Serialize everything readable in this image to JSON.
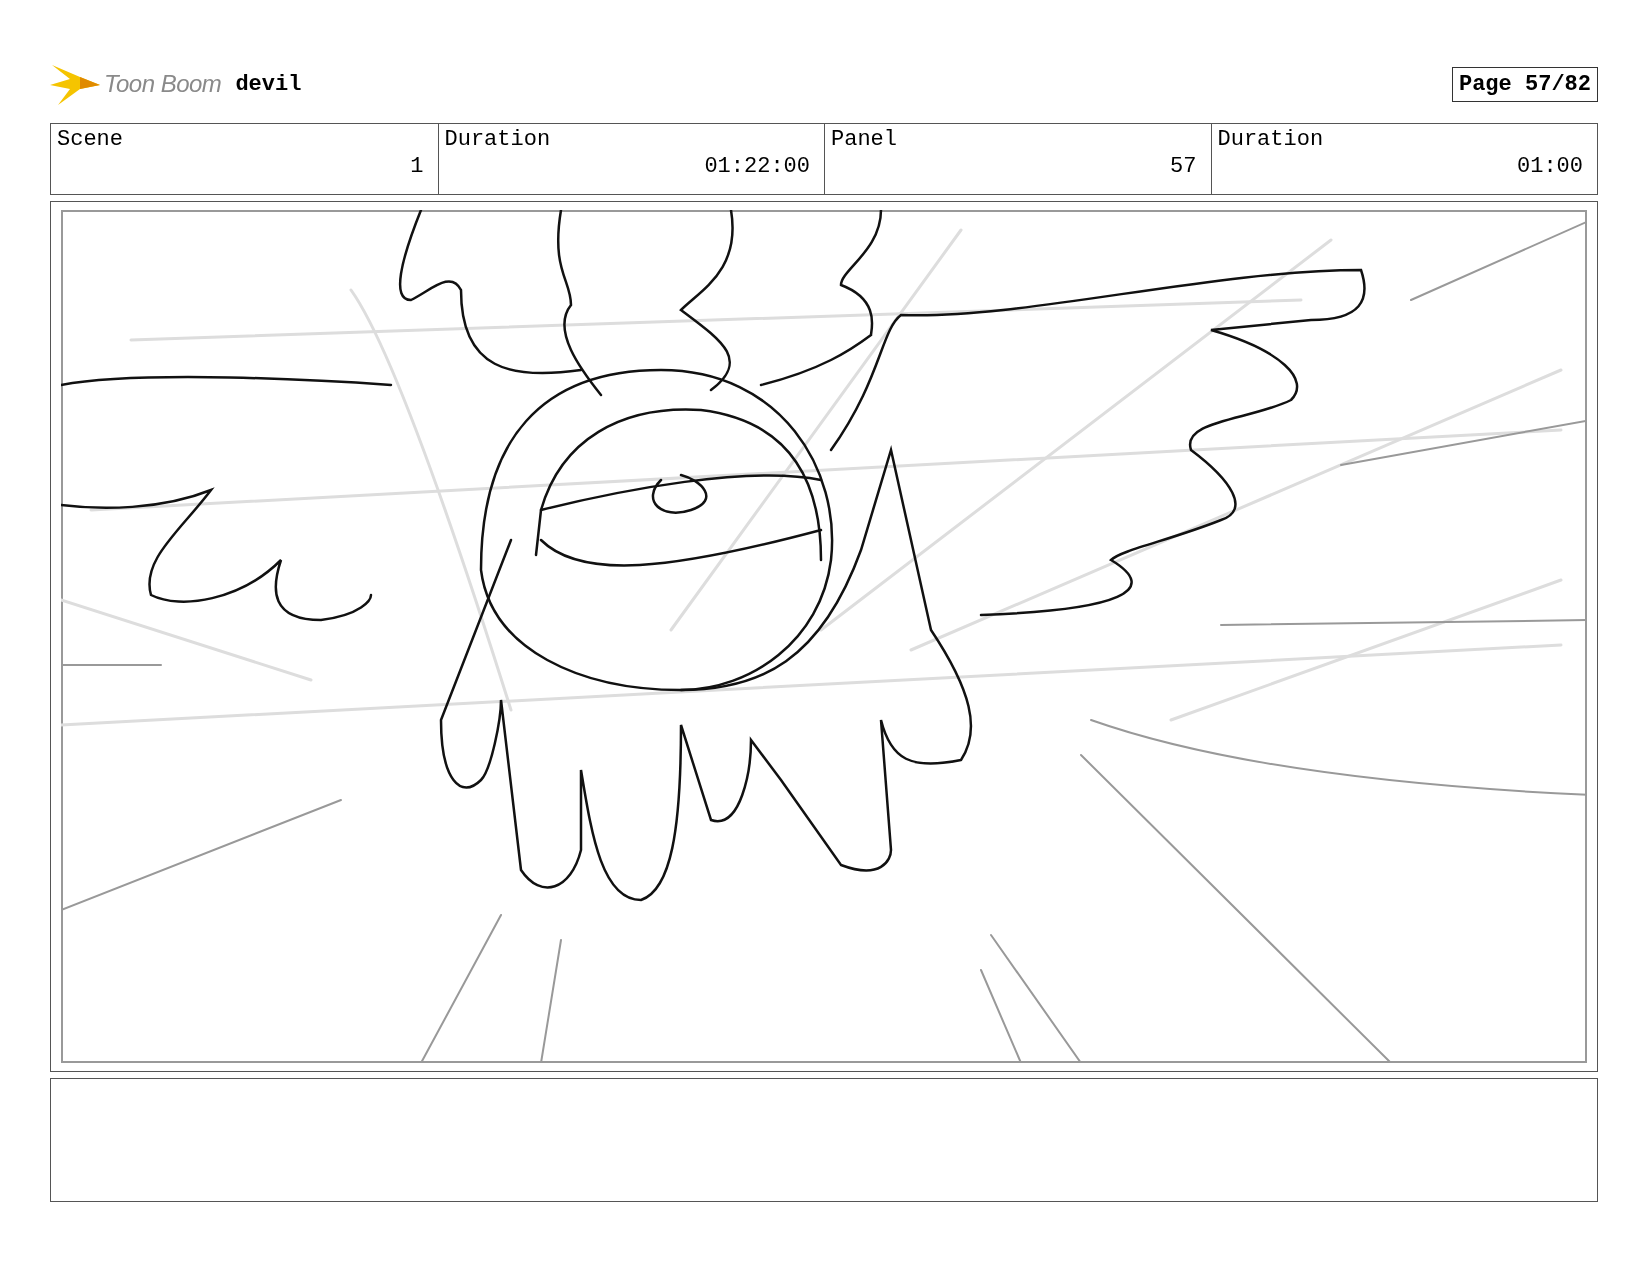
{
  "header": {
    "logo_text": "Toon Boom",
    "title": "devil",
    "page": "Page 57/82"
  },
  "fields": [
    {
      "label": "Scene",
      "value": "1"
    },
    {
      "label": "Duration",
      "value": "01:22:00"
    },
    {
      "label": "Panel",
      "value": "57"
    },
    {
      "label": "Duration",
      "value": "01:00"
    }
  ]
}
